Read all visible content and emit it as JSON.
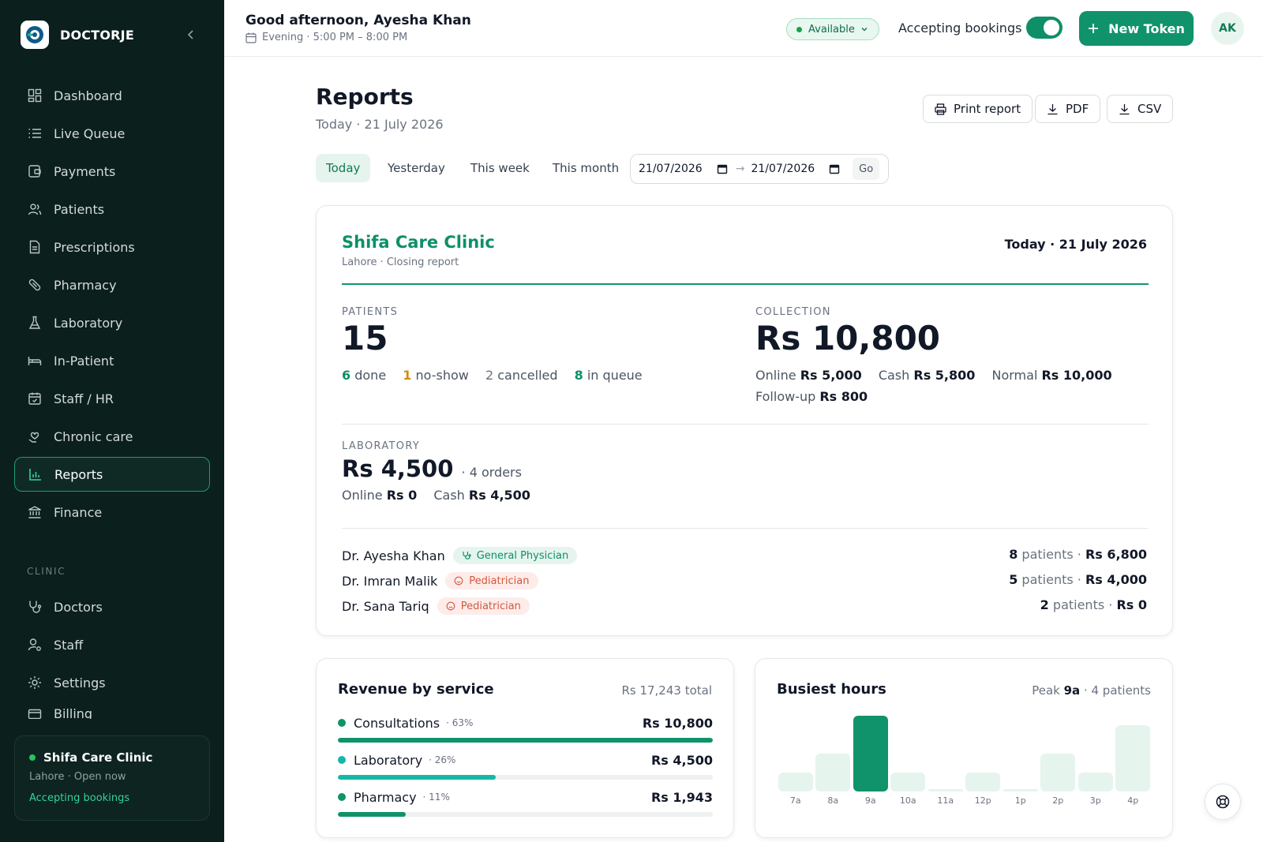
{
  "brand": {
    "name": "DOCTORJE"
  },
  "sidebar": {
    "items": [
      {
        "label": "Dashboard",
        "icon": "grid-icon"
      },
      {
        "label": "Live Queue",
        "icon": "list-icon"
      },
      {
        "label": "Payments",
        "icon": "wallet-icon"
      },
      {
        "label": "Patients",
        "icon": "users-icon"
      },
      {
        "label": "Prescriptions",
        "icon": "document-icon"
      },
      {
        "label": "Pharmacy",
        "icon": "pill-icon"
      },
      {
        "label": "Laboratory",
        "icon": "flask-icon"
      },
      {
        "label": "In-Patient",
        "icon": "bed-icon"
      },
      {
        "label": "Staff / HR",
        "icon": "calendar-check-icon"
      },
      {
        "label": "Chronic care",
        "icon": "heart-hand-icon"
      },
      {
        "label": "Reports",
        "icon": "bar-chart-icon",
        "active": true
      },
      {
        "label": "Finance",
        "icon": "bank-icon"
      }
    ],
    "section_label": "CLINIC",
    "clinic_items": [
      {
        "label": "Doctors",
        "icon": "stethoscope-icon"
      },
      {
        "label": "Staff",
        "icon": "user-cog-icon"
      },
      {
        "label": "Settings",
        "icon": "sun-gear-icon"
      },
      {
        "label": "Billing",
        "icon": "card-icon"
      }
    ],
    "clinic_card": {
      "name": "Shifa Care Clinic",
      "sub": "Lahore · Open now",
      "status": "Accepting bookings"
    }
  },
  "topbar": {
    "greeting": "Good afternoon, Ayesha Khan",
    "shift": "Evening · 5:00 PM – 8:00 PM",
    "availability": "Available",
    "accepting_label": "Accepting bookings",
    "accepting_on": true,
    "new_token": "New Token",
    "avatar": "AK"
  },
  "page": {
    "title": "Reports",
    "subtitle": "Today · 21 July 2026",
    "actions": {
      "print": "Print report",
      "pdf": "PDF",
      "csv": "CSV"
    },
    "filters": [
      "Today",
      "Yesterday",
      "This week",
      "This month"
    ],
    "date_from": "21/07/2026",
    "date_to": "21/07/2026",
    "date_arrow": "→",
    "go": "Go"
  },
  "report": {
    "clinic": "Shifa Care Clinic",
    "clinic_sub": "Lahore · Closing report",
    "date": "Today · 21 July 2026",
    "patients": {
      "label": "PATIENTS",
      "total": "15",
      "done_n": "6",
      "done_t": "done",
      "noshow_n": "1",
      "noshow_t": "no-show",
      "cancelled_n": "2",
      "cancelled_t": "cancelled",
      "queue_n": "8",
      "queue_t": "in queue"
    },
    "collection": {
      "label": "COLLECTION",
      "total": "Rs 10,800",
      "online_l": "Online",
      "online_v": "Rs 5,000",
      "cash_l": "Cash",
      "cash_v": "Rs 5,800",
      "normal_l": "Normal",
      "normal_v": "Rs 10,000",
      "followup_l": "Follow-up",
      "followup_v": "Rs 800"
    },
    "laboratory": {
      "label": "LABORATORY",
      "total": "Rs 4,500",
      "orders": "· 4 orders",
      "online_l": "Online",
      "online_v": "Rs 0",
      "cash_l": "Cash",
      "cash_v": "Rs 4,500"
    },
    "doctors": [
      {
        "name": "Dr. Ayesha Khan",
        "specialty": "General Physician",
        "patients_n": "8",
        "patients_t": "patients ·",
        "amount": "Rs 6,800"
      },
      {
        "name": "Dr. Imran Malik",
        "specialty": "Pediatrician",
        "patients_n": "5",
        "patients_t": "patients ·",
        "amount": "Rs 4,000"
      },
      {
        "name": "Dr. Sana Tariq",
        "specialty": "Pediatrician",
        "patients_n": "2",
        "patients_t": "patients ·",
        "amount": "Rs 0"
      }
    ]
  },
  "revenue": {
    "title": "Revenue by service",
    "total": "Rs 17,243 total",
    "rows": [
      {
        "name": "Consultations",
        "pct": "· 63%",
        "amount": "Rs 10,800",
        "share": 1.0,
        "color": "#10936a"
      },
      {
        "name": "Laboratory",
        "pct": "· 26%",
        "amount": "Rs 4,500",
        "share": 0.42,
        "color": "#14b8a6"
      },
      {
        "name": "Pharmacy",
        "pct": "· 11%",
        "amount": "Rs 1,943",
        "share": 0.18,
        "color": "#10936a"
      }
    ]
  },
  "hours": {
    "title": "Busiest hours",
    "peak_label": "Peak",
    "peak_hour": "9a",
    "peak_suffix": "· 4 patients",
    "chart_data": {
      "type": "bar",
      "categories": [
        "7a",
        "8a",
        "9a",
        "10a",
        "11a",
        "12p",
        "1p",
        "2p",
        "3p",
        "4p"
      ],
      "values": [
        1,
        2,
        4,
        1,
        0,
        1,
        0,
        2,
        1,
        3.5
      ],
      "ylim": [
        0,
        4
      ],
      "highlight": "9a",
      "grid": false
    }
  },
  "colors": {
    "accent": "#10936a",
    "sidebar_bg": "#0b1f1c",
    "warning": "#d08a13",
    "pediatric": "#d4583f"
  }
}
